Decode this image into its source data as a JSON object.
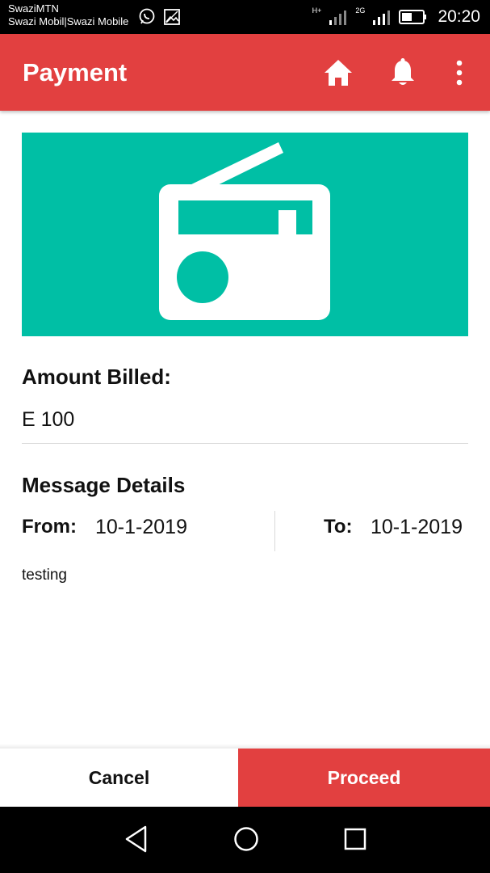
{
  "status_bar": {
    "carrier_line1": "SwaziMTN",
    "carrier_line2": "Swazi Mobil|Swazi Mobile",
    "net1": "H+",
    "net2": "2G",
    "time": "20:20"
  },
  "app_bar": {
    "title": "Payment",
    "icons": [
      "home-icon",
      "bell-icon",
      "more-vert-icon"
    ]
  },
  "banner": {
    "icon": "radio-icon",
    "background_color": "#00bfa5"
  },
  "amount": {
    "label": "Amount Billed:",
    "value": "E 100"
  },
  "message_details": {
    "heading": "Message Details",
    "from_label": "From:",
    "from_value": "10-1-2019",
    "to_label": "To:",
    "to_value": "10-1-2019",
    "text": "testing"
  },
  "actions": {
    "cancel_label": "Cancel",
    "proceed_label": "Proceed"
  },
  "colors": {
    "primary": "#e24040",
    "accent": "#00bfa5"
  }
}
